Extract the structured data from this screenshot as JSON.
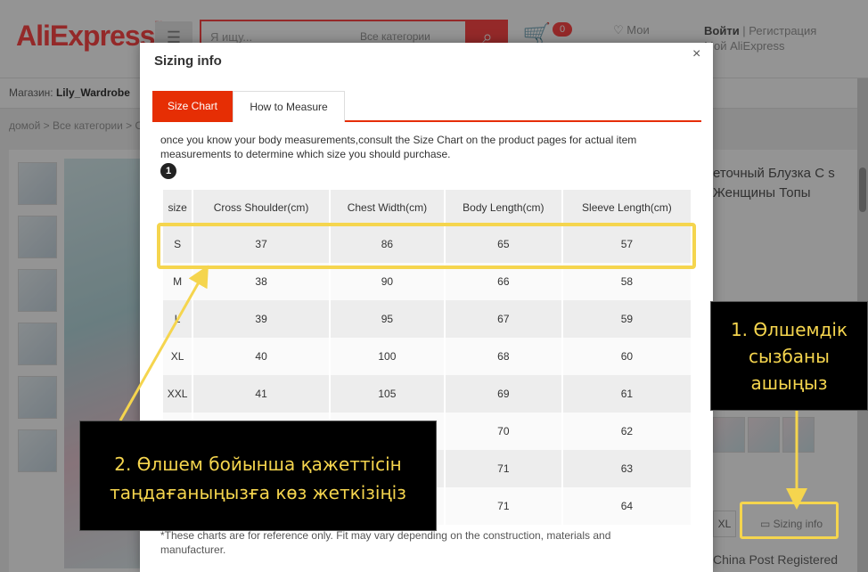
{
  "header": {
    "logo": "AliExpress",
    "search_placeholder": "Я ищу...",
    "category_select": "Все категории",
    "cart_count": "0",
    "wishlist_label": "Мои",
    "login": "Войти",
    "register": "Регистрация",
    "my_account": "Мой AliExpress"
  },
  "store": {
    "label": "Магазин:",
    "name": "Lily_Wardrobe"
  },
  "breadcrumb": "домой > Все категории > О",
  "product": {
    "title": "еточный Блузка С s Женщины Топы",
    "size_option": "XL",
    "sizing_info_link": "Sizing info",
    "shipping": "China Post Registered"
  },
  "modal": {
    "title": "Sizing info",
    "close": "×",
    "tabs": {
      "size_chart": "Size Chart",
      "how_to_measure": "How to Measure"
    },
    "intro": "once you know your body measurements,consult the Size Chart on the product pages for actual item measurements to determine which size you should purchase.",
    "step": "1",
    "table": {
      "headers": [
        "size",
        "Cross Shoulder(cm)",
        "Chest Width(cm)",
        "Body Length(cm)",
        "Sleeve Length(cm)"
      ],
      "rows": [
        [
          "S",
          "37",
          "86",
          "65",
          "57"
        ],
        [
          "M",
          "38",
          "90",
          "66",
          "58"
        ],
        [
          "L",
          "39",
          "95",
          "67",
          "59"
        ],
        [
          "XL",
          "40",
          "100",
          "68",
          "60"
        ],
        [
          "XXL",
          "41",
          "105",
          "69",
          "61"
        ],
        [
          "",
          "",
          "",
          "70",
          "62"
        ],
        [
          "",
          "",
          "",
          "71",
          "63"
        ],
        [
          "",
          "",
          "",
          "71",
          "64"
        ]
      ]
    },
    "note": "*These charts are for reference only. Fit may vary depending on the construction, materials and manufacturer."
  },
  "annotations": {
    "callout_1": [
      "1. Өлшемдік",
      "сызбаны",
      "ашыңыз"
    ],
    "callout_2": [
      "2. Өлшем бойынша қажеттісін",
      "таңдағаныңызға көз жеткізіңіз"
    ],
    "highlight_color": "#f5d54e"
  },
  "colors": {
    "brand": "#ff4747",
    "tab_active": "#e62e04"
  }
}
